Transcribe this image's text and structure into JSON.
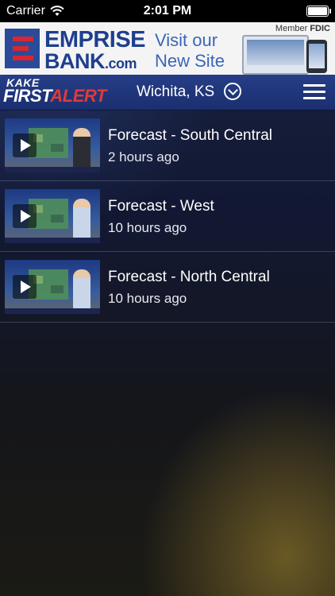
{
  "status_bar": {
    "carrier": "Carrier",
    "time": "2:01 PM",
    "wifi_icon": "wifi-icon",
    "battery_icon": "battery-full-icon"
  },
  "ad": {
    "brand_line1": "EMPRISE",
    "brand_line2": "BANK",
    "brand_suffix": ".com",
    "cta_line1": "Visit our",
    "cta_line2": "New Site",
    "member_prefix": "Member",
    "member_fdic": "FDIC"
  },
  "navbar": {
    "logo_top": "KAKE",
    "logo_first": "FIRST",
    "logo_alert": "ALERT",
    "location": "Wichita, KS",
    "location_icon": "chevron-down-circle-icon",
    "menu_icon": "hamburger-menu-icon"
  },
  "videos": [
    {
      "title": "Forecast - South Central",
      "time": "2 hours ago"
    },
    {
      "title": "Forecast - West",
      "time": "10 hours ago"
    },
    {
      "title": "Forecast - North Central",
      "time": "10 hours ago"
    }
  ],
  "colors": {
    "navbar": "#223677",
    "accent_red": "#e03a3a",
    "bank_blue": "#1e3f8e"
  }
}
